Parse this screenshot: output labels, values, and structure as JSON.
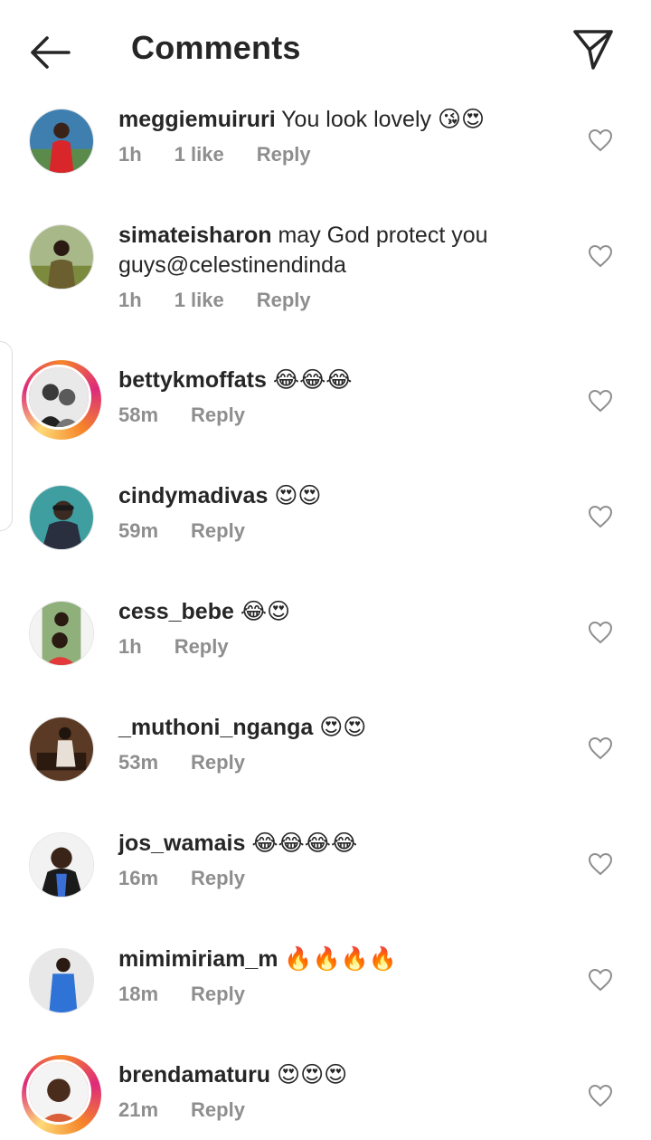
{
  "header": {
    "title": "Comments",
    "back_icon": "arrow-left-icon",
    "share_icon": "paper-plane-icon"
  },
  "colors": {
    "text": "#262626",
    "muted": "#8e8e8e",
    "story_ring": [
      "#f58529",
      "#dd2a7b",
      "#feda77"
    ]
  },
  "comments": [
    {
      "username": "meggiemuiruri",
      "text": "You look lovely 😘😍",
      "time": "1h",
      "likes": "1 like",
      "reply": "Reply",
      "story": false
    },
    {
      "username": "simateisharon",
      "text": "may God protect you guys@celestinendinda",
      "time": "1h",
      "likes": "1 like",
      "reply": "Reply",
      "story": false
    },
    {
      "username": "bettykmoffats",
      "text": "😂😂😂",
      "time": "58m",
      "likes": "",
      "reply": "Reply",
      "story": true
    },
    {
      "username": "cindymadivas",
      "text": "😍😍",
      "time": "59m",
      "likes": "",
      "reply": "Reply",
      "story": false
    },
    {
      "username": "cess_bebe",
      "text": "😂😍",
      "time": "1h",
      "likes": "",
      "reply": "Reply",
      "story": false
    },
    {
      "username": "_muthoni_nganga",
      "text": "😍😍",
      "time": "53m",
      "likes": "",
      "reply": "Reply",
      "story": false
    },
    {
      "username": "jos_wamais",
      "text": "😂😂😂😂",
      "time": "16m",
      "likes": "",
      "reply": "Reply",
      "story": false
    },
    {
      "username": "mimimiriam_m",
      "text": "🔥🔥🔥🔥",
      "time": "18m",
      "likes": "",
      "reply": "Reply",
      "story": false
    },
    {
      "username": "brendamaturu",
      "text": "😍😍😍",
      "time": "21m",
      "likes": "",
      "reply": "Reply",
      "story": true
    }
  ]
}
